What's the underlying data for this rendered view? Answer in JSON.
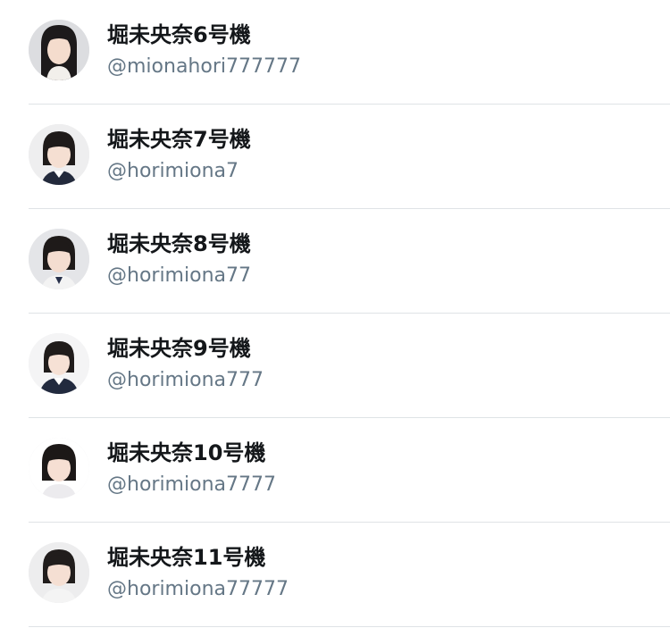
{
  "accounts": [
    {
      "display_name": "堀未央奈6号機",
      "handle": "@mionahori777777"
    },
    {
      "display_name": "堀未央奈7号機",
      "handle": "@horimiona7"
    },
    {
      "display_name": "堀未央奈8号機",
      "handle": "@horimiona77"
    },
    {
      "display_name": "堀未央奈9号機",
      "handle": "@horimiona777"
    },
    {
      "display_name": "堀未央奈10号機",
      "handle": "@horimiona7777"
    },
    {
      "display_name": "堀未央奈11号機",
      "handle": "@horimiona77777"
    }
  ],
  "colors": {
    "name_text": "#14171a",
    "handle_text": "#657786",
    "divider": "#dfe3e6"
  }
}
